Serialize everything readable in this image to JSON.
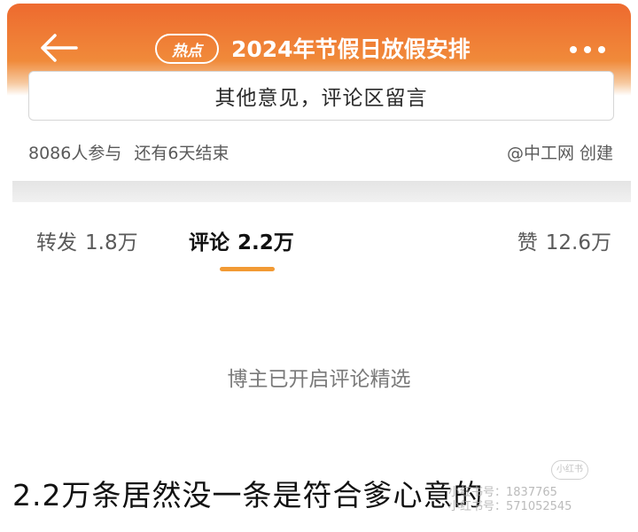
{
  "header": {
    "tag": "热点",
    "title": "2024年节假日放假安排"
  },
  "comment_box": {
    "visible_text": "其他意见，评论区留言"
  },
  "meta": {
    "participants": "8086人参与",
    "remaining": "还有6天结束",
    "creator": "@中工网 创建"
  },
  "tabs": {
    "repost": {
      "label": "转发",
      "count": "1.8万"
    },
    "comments": {
      "label": "评论",
      "count": "2.2万"
    },
    "likes": {
      "label": "赞",
      "count": "12.6万"
    }
  },
  "empty_state": "博主已开启评论精选",
  "caption": "2.2万条居然没一条是符合爹心意的",
  "watermark": {
    "logo": "小红书",
    "line1": "小红书号：1837765",
    "line2": "小红书号：571052545"
  },
  "colors": {
    "header_start": "#ee6a2f",
    "header_end": "#f08a3a",
    "accent": "#f29a34"
  },
  "icons": [
    "back-arrow-icon",
    "more-dots-icon"
  ]
}
